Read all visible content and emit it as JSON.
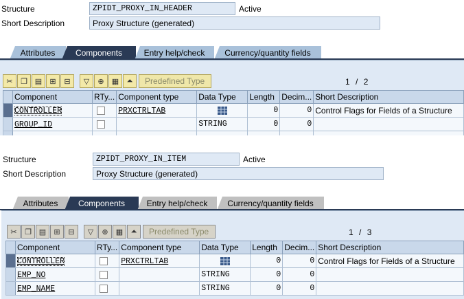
{
  "panels": [
    {
      "structure_label": "Structure",
      "structure_value": "ZPIDT_PROXY_IN_HEADER",
      "status": "Active",
      "desc_label": "Short Description",
      "desc_value": "Proxy Structure (generated)",
      "tabs": [
        "Attributes",
        "Components",
        "Entry help/check",
        "Currency/quantity fields"
      ],
      "active_tab": "Components",
      "toolbar": {
        "predefined_type": "Predefined Type"
      },
      "pager": {
        "current": "1",
        "sep": "/",
        "total": "2"
      },
      "columns": [
        "Component",
        "RTy...",
        "Component type",
        "Data Type",
        "Length",
        "Decim...",
        "Short Description"
      ],
      "rows": [
        {
          "component": "CONTROLLER",
          "type": "PRXCTRLTAB",
          "datatype_icon": "table-type-icon",
          "datatype": "",
          "length": "0",
          "decimals": "0",
          "desc": "Control Flags for Fields of a Structure"
        },
        {
          "component": "GROUP_ID",
          "type": "",
          "datatype_icon": "",
          "datatype": "STRING",
          "length": "0",
          "decimals": "0",
          "desc": ""
        }
      ]
    },
    {
      "structure_label": "Structure",
      "structure_value": "ZPIDT_PROXY_IN_ITEM",
      "status": "Active",
      "desc_label": "Short Description",
      "desc_value": "Proxy Structure (generated)",
      "tabs": [
        "Attributes",
        "Components",
        "Entry help/check",
        "Currency/quantity fields"
      ],
      "active_tab": "Components",
      "toolbar": {
        "predefined_type": "Predefined Type"
      },
      "pager": {
        "current": "1",
        "sep": "/",
        "total": "3"
      },
      "columns": [
        "Component",
        "RTy...",
        "Component type",
        "Data Type",
        "Length",
        "Decim...",
        "Short Description"
      ],
      "rows": [
        {
          "component": "CONTROLLER",
          "type": "PRXCTRLTAB",
          "datatype_icon": "table-type-icon",
          "datatype": "",
          "length": "0",
          "decimals": "0",
          "desc": "Control Flags for Fields of a Structure"
        },
        {
          "component": "EMP_NO",
          "type": "",
          "datatype_icon": "",
          "datatype": "STRING",
          "length": "0",
          "decimals": "0",
          "desc": ""
        },
        {
          "component": "EMP_NAME",
          "type": "",
          "datatype_icon": "",
          "datatype": "STRING",
          "length": "0",
          "decimals": "0",
          "desc": ""
        }
      ]
    }
  ],
  "colors": {
    "tab_active": "#2a3a55",
    "tab_inactive": "#a9c1da",
    "work_bg": "#dfe9f5"
  }
}
